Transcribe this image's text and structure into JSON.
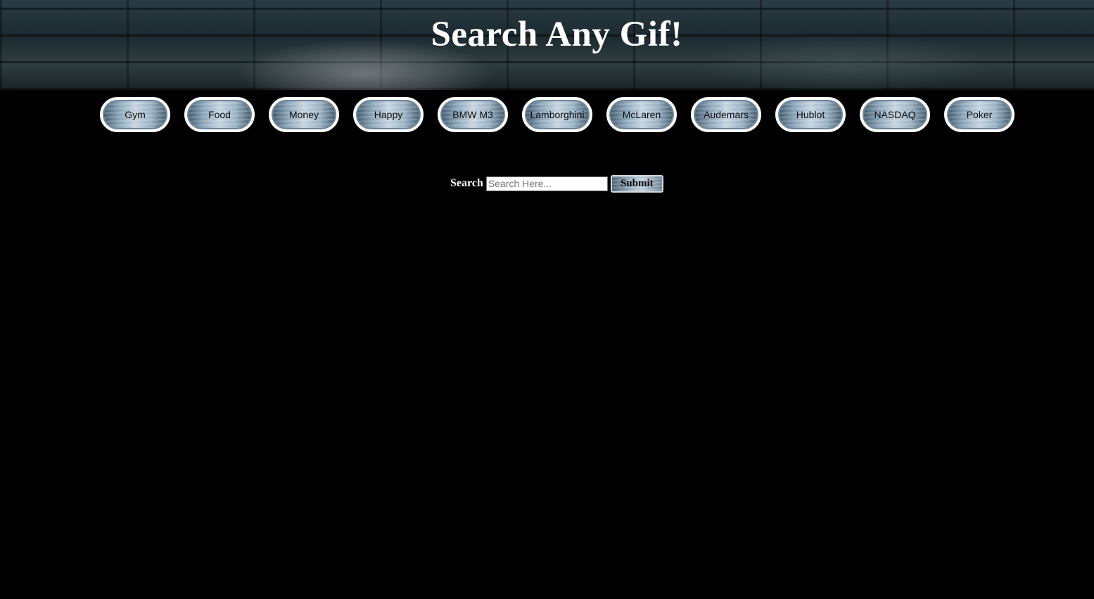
{
  "header": {
    "title": "Search Any Gif!"
  },
  "nav": {
    "buttons": [
      "Gym",
      "Food",
      "Money",
      "Happy",
      "BMW M3",
      "Lamborghini",
      "McLaren",
      "Audemars",
      "Hublot",
      "NASDAQ",
      "Poker"
    ]
  },
  "search": {
    "label": "Search",
    "placeholder": "Search Here...",
    "value": "",
    "submit_label": "Submit"
  },
  "colors": {
    "background": "#000000",
    "title": "#ffffff",
    "button_border": "#ffffff"
  }
}
